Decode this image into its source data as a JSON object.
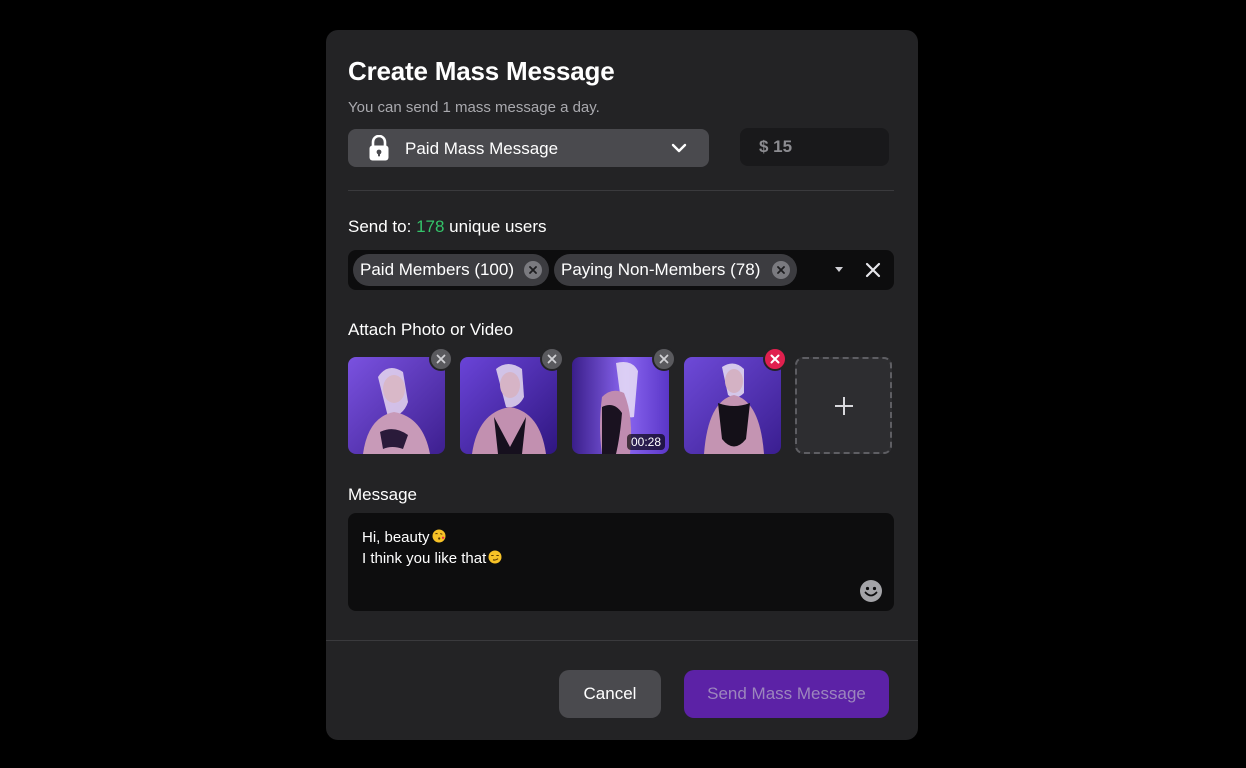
{
  "modal": {
    "title": "Create Mass Message",
    "subtitle": "You can send 1 mass message a day."
  },
  "message_type": {
    "icon": "lock-icon",
    "selected": "Paid Mass Message"
  },
  "price": {
    "value": "$ 15"
  },
  "send_to": {
    "prefix": "Send to:",
    "count": "178",
    "suffix": "unique users",
    "count_color": "#34c46a",
    "chips": [
      {
        "label": "Paid Members (100)"
      },
      {
        "label": "Paying Non-Members (78)"
      }
    ]
  },
  "attach": {
    "label": "Attach Photo or Video",
    "items": [
      {
        "type": "photo"
      },
      {
        "type": "photo"
      },
      {
        "type": "video",
        "duration": "00:28"
      },
      {
        "type": "photo",
        "remove_highlighted": true
      }
    ]
  },
  "message": {
    "label": "Message",
    "lines": [
      "Hi, beauty",
      "I think you like that"
    ]
  },
  "actions": {
    "cancel_label": "Cancel",
    "send_label": "Send Mass Message"
  },
  "colors": {
    "accent": "#5c22a6",
    "remove_active": "#e0204e",
    "modal_bg": "#232325"
  }
}
